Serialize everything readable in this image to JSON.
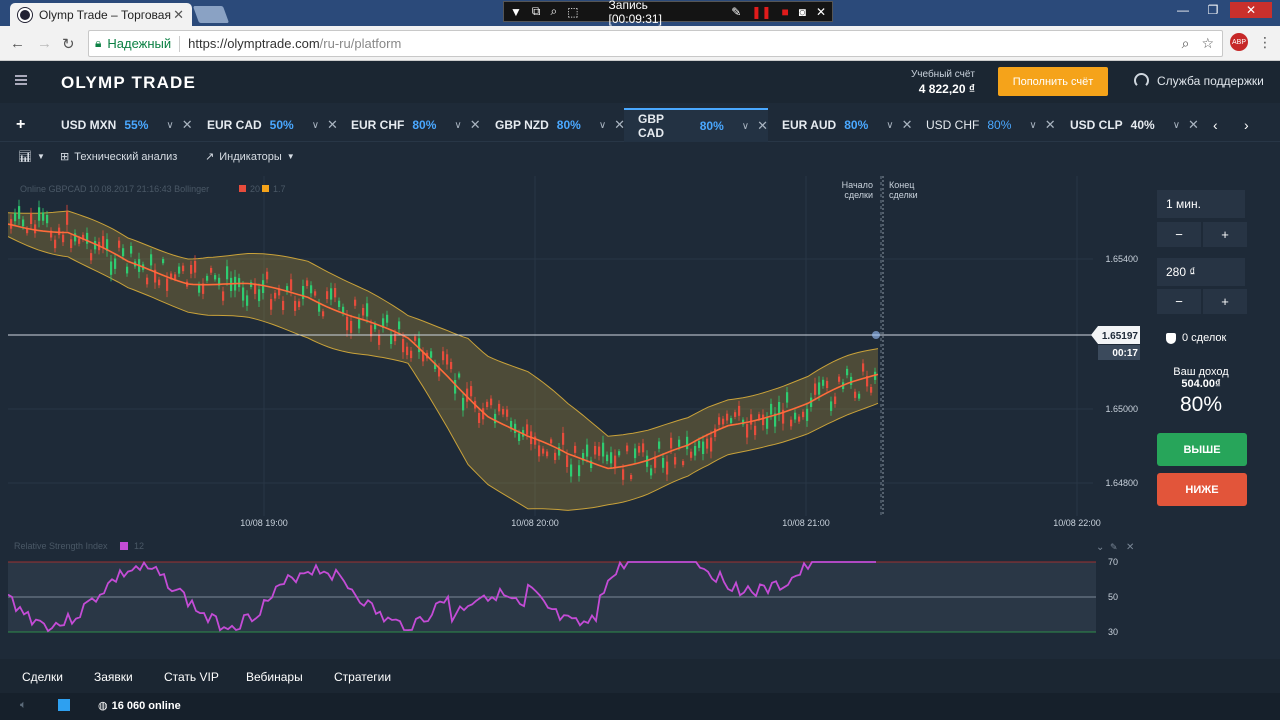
{
  "browser": {
    "tab_title": "Olymp Trade – Торговая",
    "secure_label": "Надежный",
    "url_host": "https://olymptrade.com",
    "url_path": "/ru-ru/platform",
    "recorder_label": "Запись [00:09:31]"
  },
  "header": {
    "logo_main": "OLYMP TRADE",
    "account_label": "Учебный счёт",
    "account_balance": "4 822,20 ₫",
    "deposit_label": "Пополнить счёт",
    "support_label": "Служба поддержки"
  },
  "assets": [
    {
      "name": "USD MXN",
      "pct": "55%"
    },
    {
      "name": "EUR CAD",
      "pct": "50%"
    },
    {
      "name": "EUR CHF",
      "pct": "80%"
    },
    {
      "name": "GBP NZD",
      "pct": "80%"
    },
    {
      "name": "GBP CAD",
      "pct": "80%"
    },
    {
      "name": "EUR AUD",
      "pct": "80%"
    },
    {
      "name": "USD CHF",
      "pct": "80%"
    },
    {
      "name": "USD CLP",
      "pct": "40%"
    }
  ],
  "toolbar": {
    "tech_analysis": "Технический анализ",
    "indicators": "Индикаторы"
  },
  "chart": {
    "legend": "Online GBPCAD 10.08.2017 21:16:43 Bollinger",
    "legend_vals": [
      "20",
      "1.7"
    ],
    "start_label_1": "Начало",
    "start_label_2": "сделки",
    "end_label_1": "Конец",
    "end_label_2": "сделки",
    "price_ticks": [
      "1.65400",
      "1.65000",
      "1.64800"
    ],
    "time_ticks": [
      "10/08 19:00",
      "10/08 20:00",
      "10/08 21:00",
      "10/08 22:00"
    ],
    "current_price": "1.65197",
    "countdown": "00:17",
    "colors": {
      "up": "#2ecc71",
      "down": "#e74c3c",
      "band": "#c9a23a",
      "ma": "#ff6b3a"
    }
  },
  "rsi": {
    "label": "Relative Strength Index",
    "period": "12",
    "levels": [
      "70",
      "50",
      "30"
    ],
    "color": "#c44cd6"
  },
  "panel": {
    "duration": "1 мин.",
    "amount": "280 ₫",
    "deals": "0 сделок",
    "income_label": "Ваш доход",
    "income_value": "504.00₫",
    "income_pct": "80%",
    "up_label": "ВЫШЕ",
    "down_label": "НИЖЕ"
  },
  "bottom_tabs": [
    "Сделки",
    "Заявки",
    "Стать VIP",
    "Вебинары",
    "Стратегии"
  ],
  "status": {
    "online": "16 060 online"
  }
}
